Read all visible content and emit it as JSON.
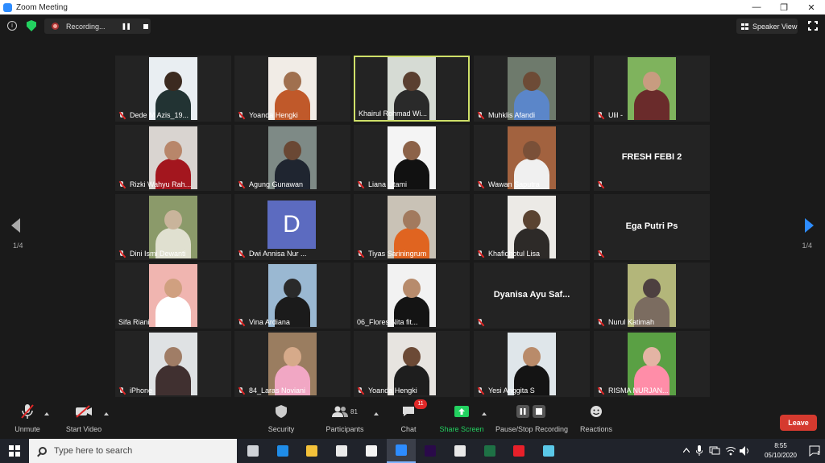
{
  "window": {
    "title": "Zoom Meeting",
    "buttons": [
      "—",
      "❐",
      "✕"
    ]
  },
  "topbar": {
    "recording_label": "Recording...",
    "pause_glyph": "❚❚",
    "view_label": "Speaker View"
  },
  "gallery": {
    "page_left": "1/4",
    "page_right": "1/4",
    "tiles": [
      {
        "name": "Dede M Azis_19...",
        "kind": "video",
        "bg": "#e9eef2",
        "skin": "#3b2a20",
        "shirt": "#233",
        "mic_off": true
      },
      {
        "name": "Yoanda Hengki",
        "kind": "video",
        "bg": "#f1ece6",
        "skin": "#a0704f",
        "shirt": "#c0592a",
        "mic_off": true
      },
      {
        "name": "Khairul Rohmad Wi...",
        "kind": "video",
        "bg": "#d6dbd4",
        "skin": "#5a3f30",
        "shirt": "#2a2a2a",
        "mic_off": false,
        "active": true
      },
      {
        "name": "Muhklis Afandi",
        "kind": "video",
        "bg": "#6e7a6c",
        "skin": "#6d4b36",
        "shirt": "#5b86c9",
        "mic_off": true
      },
      {
        "name": "Ulil -",
        "kind": "video",
        "bg": "#7fb35d",
        "skin": "#c89c80",
        "shirt": "#6a2b2b",
        "mic_off": true
      },
      {
        "name": "Rizki Wahyu Rah...",
        "kind": "video",
        "bg": "#d9d4d0",
        "skin": "#b8866a",
        "shirt": "#a3161e",
        "mic_off": true
      },
      {
        "name": "Agung Gunawan",
        "kind": "video",
        "bg": "#7e8a86",
        "skin": "#6a4834",
        "shirt": "#1f2530",
        "mic_off": true
      },
      {
        "name": "Liana Utami",
        "kind": "video",
        "bg": "#f4f4f4",
        "skin": "#8c6248",
        "shirt": "#111111",
        "mic_off": true
      },
      {
        "name": "Wawan Saputra",
        "kind": "video",
        "bg": "#a2623f",
        "skin": "#7a5038",
        "shirt": "#f0f0f0",
        "mic_off": true
      },
      {
        "name": "FRESH FEBI 2",
        "kind": "name",
        "mic_off": true
      },
      {
        "name": "Dini Ismi Dewanti",
        "kind": "video",
        "bg": "#8b9a6a",
        "skin": "#c9b49b",
        "shirt": "#e0e0d0",
        "mic_off": true
      },
      {
        "name": "Dwi Annisa Nur ...",
        "kind": "avatar",
        "mic_off": true
      },
      {
        "name": "Tiyas Sariningrum",
        "kind": "video",
        "bg": "#c9c2b6",
        "skin": "#a27a5e",
        "shirt": "#e06420",
        "mic_off": true
      },
      {
        "name": "Khafidhotul Lisa",
        "kind": "video",
        "bg": "#eceae6",
        "skin": "#5a4331",
        "shirt": "#2d2a28",
        "mic_off": true
      },
      {
        "name": "Ega Putri Ps",
        "kind": "name",
        "mic_off": true
      },
      {
        "name": "Sifa Riani",
        "kind": "video",
        "bg": "#f0b5b0",
        "skin": "#d0a080",
        "shirt": "#ffffff",
        "mic_off": false
      },
      {
        "name": "Vina Ardiana",
        "kind": "video",
        "bg": "#9ab8d2",
        "skin": "#2a2a2a",
        "shirt": "#1b1b1b",
        "mic_off": true
      },
      {
        "name": "06_Flores Nita fit...",
        "kind": "video",
        "bg": "#f2f2f2",
        "skin": "#b78b6c",
        "shirt": "#141414",
        "mic_off": false
      },
      {
        "name": "Dyanisa Ayu Saf...",
        "kind": "name",
        "mic_off": true
      },
      {
        "name": "Nurul Katimah",
        "kind": "video",
        "bg": "#b3b67a",
        "skin": "#4d4040",
        "shirt": "#7b6c60",
        "mic_off": true
      },
      {
        "name": "iPhone",
        "kind": "video",
        "bg": "#dfe2e4",
        "skin": "#a07d66",
        "shirt": "#403030",
        "mic_off": true
      },
      {
        "name": "84_Laras Noviani",
        "kind": "video",
        "bg": "#9a7d60",
        "skin": "#d6aa8a",
        "shirt": "#f1a7c4",
        "mic_off": true
      },
      {
        "name": "Yoanda Hengki",
        "kind": "video",
        "bg": "#e7e4e0",
        "skin": "#6c4a36",
        "shirt": "#1e1e1e",
        "mic_off": true
      },
      {
        "name": "Yesi Anggita S",
        "kind": "video",
        "bg": "#dfe6ea",
        "skin": "#b98b6a",
        "shirt": "#141414",
        "mic_off": true
      },
      {
        "name": "RISMA NURJAN...",
        "kind": "video",
        "bg": "#5aa044",
        "skin": "#e4b4a4",
        "shirt": "#ff8da8",
        "mic_off": true
      }
    ],
    "avatar_letter": "D"
  },
  "toolbar": {
    "unmute": "Unmute",
    "start_video": "Start Video",
    "security": "Security",
    "participants": "Participants",
    "participant_count": "81",
    "chat": "Chat",
    "chat_badge": "11",
    "share_screen": "Share Screen",
    "recording": "Pause/Stop Recording",
    "reactions": "Reactions",
    "leave": "Leave"
  },
  "taskbar": {
    "search_placeholder": "Type here to search",
    "time": "8:55",
    "date": "05/10/2020",
    "notification_count": "1",
    "apps": [
      {
        "name": "task-view",
        "color": "#cfd2d8"
      },
      {
        "name": "edge",
        "color": "#1f8ce8"
      },
      {
        "name": "file-explorer",
        "color": "#f3c13a"
      },
      {
        "name": "store",
        "color": "#eaeaea"
      },
      {
        "name": "mail",
        "color": "#f4f4f4"
      },
      {
        "name": "zoom",
        "color": "#2d8cff",
        "active": true
      },
      {
        "name": "premiere",
        "color": "#2a0a4a"
      },
      {
        "name": "settings",
        "color": "#e8e8e8"
      },
      {
        "name": "excel",
        "color": "#1e7145"
      },
      {
        "name": "opera",
        "color": "#e8202a"
      },
      {
        "name": "paint",
        "color": "#5ac8e8"
      }
    ]
  },
  "colors": {
    "active_speaker": "#cfe069",
    "share_green": "#23d160",
    "leave_red": "#d53a2f",
    "accent_blue": "#2d8cff"
  }
}
